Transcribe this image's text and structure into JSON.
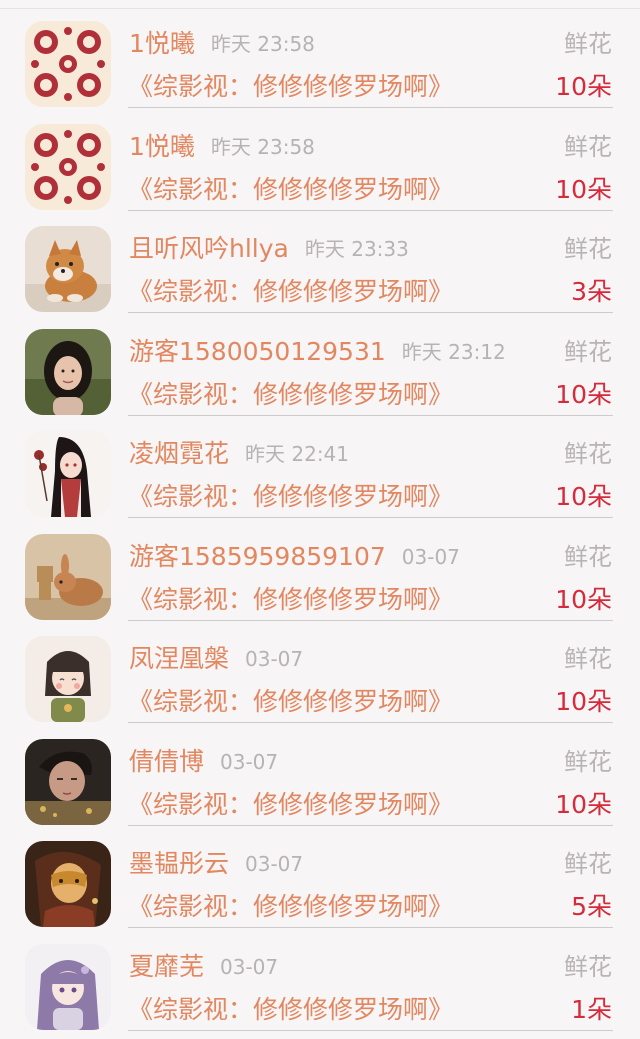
{
  "screen": {
    "title": "",
    "items": [
      {
        "user": "1悦曦",
        "time": "昨天 23:58",
        "type": "鲜花",
        "book": "《综影视：修修修修罗场啊》",
        "amount": "10朵",
        "avatar": "paper-cut-pattern-icon"
      },
      {
        "user": "1悦曦",
        "time": "昨天 23:58",
        "type": "鲜花",
        "book": "《综影视：修修修修罗场啊》",
        "amount": "10朵",
        "avatar": "paper-cut-pattern-icon"
      },
      {
        "user": "且听风吟hllya",
        "time": "昨天 23:33",
        "type": "鲜花",
        "book": "《综影视：修修修修罗场啊》",
        "amount": "3朵",
        "avatar": "shiba-dog-icon"
      },
      {
        "user": "游客1580050129531",
        "time": "昨天 23:12",
        "type": "鲜花",
        "book": "《综影视：修修修修罗场啊》",
        "amount": "10朵",
        "avatar": "woman-photo-icon"
      },
      {
        "user": "凌烟霓花",
        "time": "昨天 22:41",
        "type": "鲜花",
        "book": "《综影视：修修修修罗场啊》",
        "amount": "10朵",
        "avatar": "anime-girl-icon"
      },
      {
        "user": "游客1585959859107",
        "time": "03-07",
        "type": "鲜花",
        "book": "《综影视：修修修修罗场啊》",
        "amount": "10朵",
        "avatar": "rabbit-box-icon"
      },
      {
        "user": "凤涅凰槃",
        "time": "03-07",
        "type": "鲜花",
        "book": "《综影视：修修修修罗场啊》",
        "amount": "10朵",
        "avatar": "cartoon-girl-icon"
      },
      {
        "user": "倩倩博",
        "time": "03-07",
        "type": "鲜花",
        "book": "《综影视：修修修修罗场啊》",
        "amount": "10朵",
        "avatar": "man-portrait-icon"
      },
      {
        "user": "墨韫彤云",
        "time": "03-07",
        "type": "鲜花",
        "book": "《综影视：修修修修罗场啊》",
        "amount": "5朵",
        "avatar": "mask-character-icon"
      },
      {
        "user": "夏靡芜",
        "time": "03-07",
        "type": "鲜花",
        "book": "《综影视：修修修修罗场啊》",
        "amount": "1朵",
        "avatar": "purple-hair-girl-icon"
      }
    ]
  }
}
